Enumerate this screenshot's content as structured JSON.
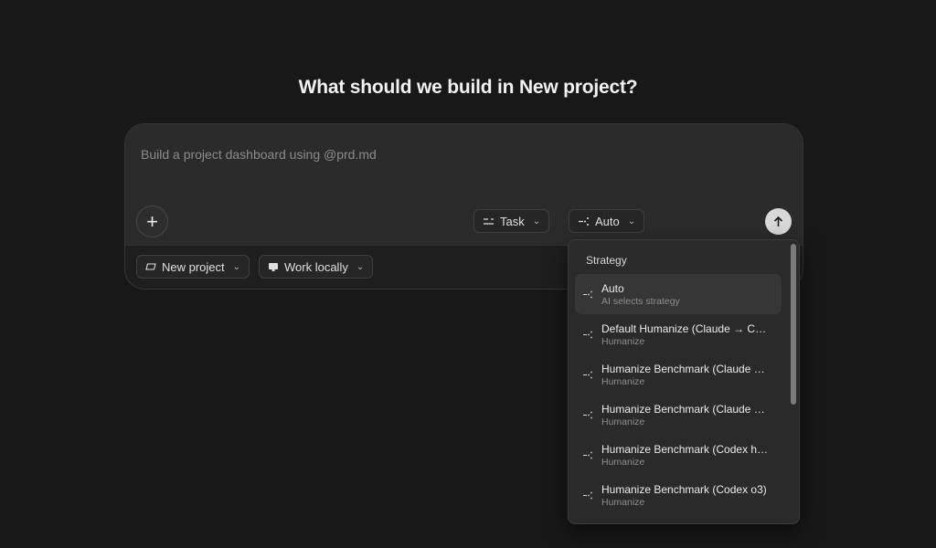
{
  "heading": "What should we build in New project?",
  "composer": {
    "placeholder": "Build a project dashboard using @prd.md",
    "mode_label": "Task",
    "strategy_label": "Auto",
    "project_label": "New project",
    "location_label": "Work locally"
  },
  "icons": {
    "add": "plus-icon",
    "mode": "task-icon",
    "strategy": "strategy-icon",
    "send": "arrow-up-icon",
    "project": "folder-icon",
    "location": "monitor-icon",
    "chevron": "chevron-down-icon"
  },
  "strategy_menu": {
    "title": "Strategy",
    "items": [
      {
        "title": "Auto",
        "subtitle": "AI selects strategy",
        "active": true
      },
      {
        "title": "Default Humanize (Claude → Codex)",
        "subtitle": "Humanize"
      },
      {
        "title": "Humanize Benchmark (Claude opus)",
        "subtitle": "Humanize"
      },
      {
        "title": "Humanize Benchmark (Claude sonnet)",
        "subtitle": "Humanize"
      },
      {
        "title": "Humanize Benchmark (Codex high)",
        "subtitle": "Humanize"
      },
      {
        "title": "Humanize Benchmark (Codex o3)",
        "subtitle": "Humanize"
      }
    ]
  },
  "colors": {
    "background": "#181818",
    "composer_top": "#2b2b2b",
    "menu_bg": "#2a2a2a",
    "send_button": "#d8d8d8"
  }
}
